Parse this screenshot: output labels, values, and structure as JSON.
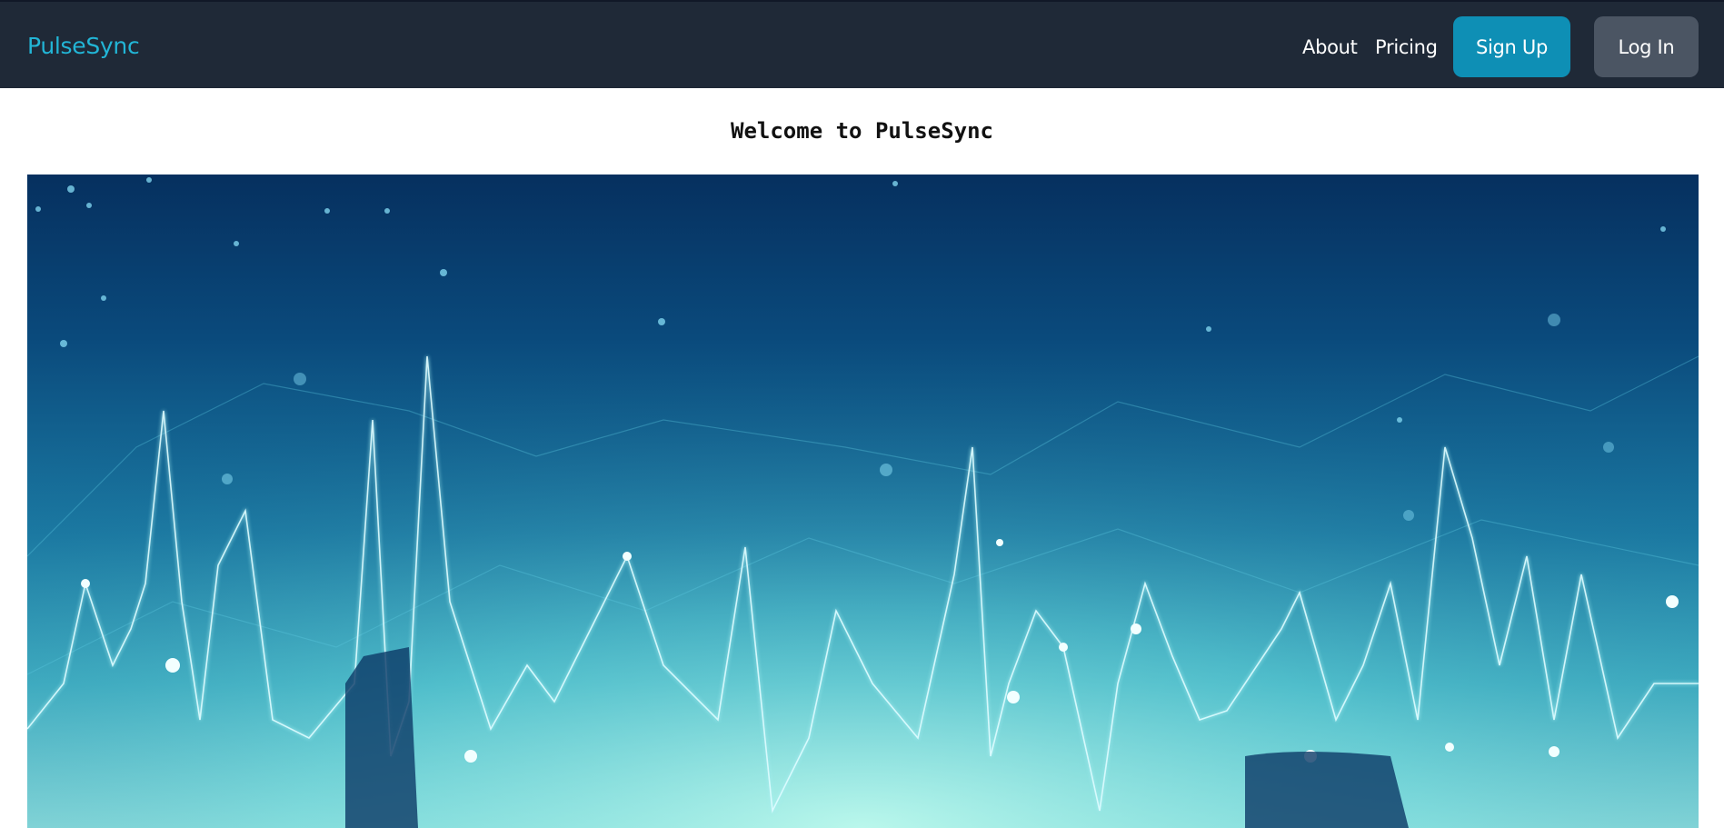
{
  "navbar": {
    "brand": "PulseSync",
    "links": [
      {
        "label": "About"
      },
      {
        "label": "Pricing"
      }
    ],
    "signup_label": "Sign Up",
    "login_label": "Log In"
  },
  "main": {
    "welcome_text": "Welcome to PulseSync"
  },
  "colors": {
    "navbar_bg": "#1f2937",
    "brand": "#22b5d6",
    "signup_bg": "#0e8fb5",
    "login_bg": "#4b5563"
  },
  "hero": {
    "icon": "pulse-wave-image"
  }
}
